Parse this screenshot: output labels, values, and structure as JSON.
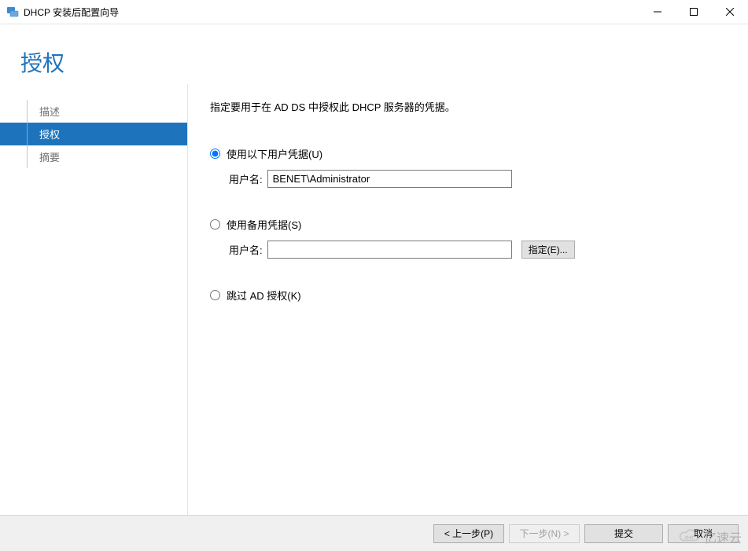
{
  "window": {
    "title": "DHCP 安装后配置向导"
  },
  "page": {
    "heading": "授权"
  },
  "sidebar": {
    "items": [
      {
        "label": "描述",
        "active": false
      },
      {
        "label": "授权",
        "active": true
      },
      {
        "label": "摘要",
        "active": false
      }
    ]
  },
  "main": {
    "instruction": "指定要用于在 AD DS 中授权此 DHCP 服务器的凭据。",
    "option1": {
      "label": "使用以下用户凭据(U)",
      "checked": true,
      "username_label": "用户名:",
      "username_value": "BENET\\Administrator"
    },
    "option2": {
      "label": "使用备用凭据(S)",
      "checked": false,
      "username_label": "用户名:",
      "username_value": "",
      "specify_button": "指定(E)..."
    },
    "option3": {
      "label": "跳过 AD 授权(K)",
      "checked": false
    }
  },
  "footer": {
    "previous": "< 上一步(P)",
    "next": "下一步(N) >",
    "commit": "提交",
    "cancel": "取消"
  },
  "watermark": "亿速云"
}
